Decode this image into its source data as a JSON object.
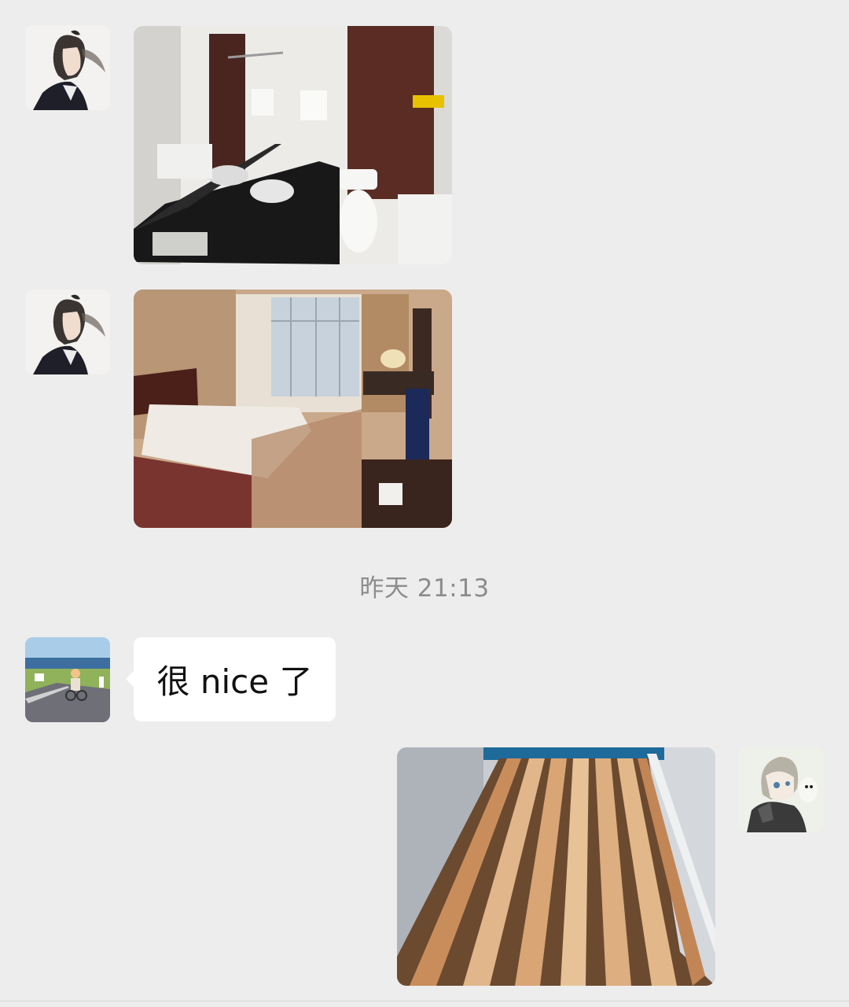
{
  "conversation": {
    "messages": [
      {
        "sender": "contact-a",
        "type": "image",
        "avatar_icon": "anime-longhair-avatar-icon",
        "image_subject": "hotel bathroom"
      },
      {
        "sender": "contact-a",
        "type": "image",
        "avatar_icon": "anime-longhair-avatar-icon",
        "image_subject": "hotel bedroom"
      },
      {
        "type": "timestamp",
        "text": "昨天 21:13"
      },
      {
        "sender": "contact-b",
        "type": "text",
        "avatar_icon": "road-cyclist-avatar-icon",
        "text": "很 nice 了"
      },
      {
        "sender": "self",
        "type": "image",
        "avatar_icon": "anime-boy-avatar-icon",
        "image_subject": "wooden bed slats"
      }
    ]
  },
  "colors": {
    "background": "#ededed",
    "received_bubble": "#ffffff",
    "timestamp_text": "#8c8c8c"
  }
}
